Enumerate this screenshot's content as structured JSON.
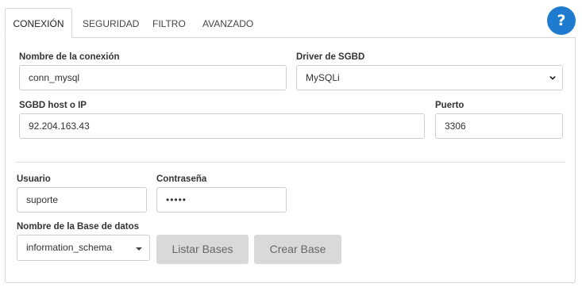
{
  "tabs": [
    {
      "label": "CONEXIÓN",
      "active": true
    },
    {
      "label": "SEGURIDAD",
      "active": false
    },
    {
      "label": "FILTRO",
      "active": false
    },
    {
      "label": "AVANZADO",
      "active": false
    }
  ],
  "help": {
    "label": "?",
    "color": "#1e7bd0"
  },
  "connection": {
    "name_label": "Nombre de la conexión",
    "name_value": "conn_mysql",
    "driver_label": "Driver de SGBD",
    "driver_value": "MySQLi",
    "host_label": "SGBD host o IP",
    "host_value": "92.204.163.43",
    "port_label": "Puerto",
    "port_value": "3306"
  },
  "credentials": {
    "user_label": "Usuario",
    "user_value": "suporte",
    "password_label": "Contraseña",
    "password_value": "•••••"
  },
  "database": {
    "label": "Nombre de la Base de datos",
    "value": "information_schema",
    "list_button": "Listar Bases",
    "create_button": "Crear Base"
  }
}
